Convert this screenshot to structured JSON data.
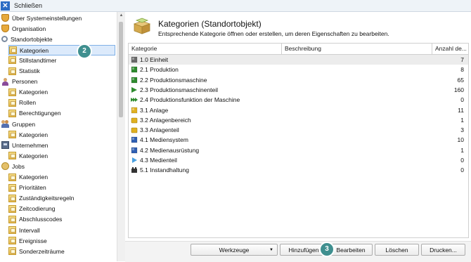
{
  "window": {
    "title": "Schließen"
  },
  "sidebar": {
    "items": [
      {
        "label": "Über Systemeinstellungen",
        "icon": "shield-icon",
        "level": 0
      },
      {
        "label": "Organisation",
        "icon": "shield-icon",
        "level": 0
      },
      {
        "label": "Standortobjekte",
        "icon": "search-icon",
        "level": 0
      },
      {
        "label": "Kategorien",
        "icon": "folder-icon",
        "level": 1,
        "selected": true
      },
      {
        "label": "Stillstandtimer",
        "icon": "folder-icon",
        "level": 1
      },
      {
        "label": "Statistik",
        "icon": "folder-icon",
        "level": 1
      },
      {
        "label": "Personen",
        "icon": "person-icon",
        "level": 0
      },
      {
        "label": "Kategorien",
        "icon": "folder-icon",
        "level": 1
      },
      {
        "label": "Rollen",
        "icon": "folder-icon",
        "level": 1
      },
      {
        "label": "Berechtigungen",
        "icon": "folder-icon",
        "level": 1
      },
      {
        "label": "Gruppen",
        "icon": "group-icon",
        "level": 0
      },
      {
        "label": "Kategorien",
        "icon": "folder-icon",
        "level": 1
      },
      {
        "label": "Unternehmen",
        "icon": "company-icon",
        "level": 0
      },
      {
        "label": "Kategorien",
        "icon": "folder-icon",
        "level": 1
      },
      {
        "label": "Jobs",
        "icon": "jobs-icon",
        "level": 0
      },
      {
        "label": "Kategorien",
        "icon": "folder-icon",
        "level": 1
      },
      {
        "label": "Prioritäten",
        "icon": "folder-icon",
        "level": 1
      },
      {
        "label": "Zuständigkeitsregeln",
        "icon": "folder-icon",
        "level": 1
      },
      {
        "label": "Zeitcodierung",
        "icon": "folder-icon",
        "level": 1
      },
      {
        "label": "Abschlusscodes",
        "icon": "folder-icon",
        "level": 1
      },
      {
        "label": "Intervall",
        "icon": "folder-icon",
        "level": 1
      },
      {
        "label": "Ereignisse",
        "icon": "folder-icon",
        "level": 1
      },
      {
        "label": "Sonderzeiträume",
        "icon": "folder-icon",
        "level": 1
      }
    ]
  },
  "badges": {
    "b2": "2",
    "b3": "3"
  },
  "main": {
    "title": "Kategorien (Standortobjekt)",
    "subtitle": "Entsprechende Kategorie öffnen oder erstellen, um deren Eigenschaften zu bearbeiten.",
    "columns": [
      "Kategorie",
      "Beschreibung",
      "Anzahl de..."
    ],
    "rows": [
      {
        "name": "1.0 Einheit",
        "count": "7",
        "icon": "unit-icon",
        "color": "#6b6b6b"
      },
      {
        "name": "2.1 Produktion",
        "count": "8",
        "icon": "production-icon",
        "color": "#2e8b2e"
      },
      {
        "name": "2.2 Produktionsmaschine",
        "count": "65",
        "icon": "machine-icon",
        "color": "#2e8b2e"
      },
      {
        "name": "2.3 Produktionsmaschinenteil",
        "count": "160",
        "icon": "machine-part-icon",
        "color": "#2e8b2e"
      },
      {
        "name": "2.4 Produktionsfunktion der Maschine",
        "count": "0",
        "icon": "machine-function-icon",
        "color": "#2e8b2e"
      },
      {
        "name": "3.1 Anlage",
        "count": "11",
        "icon": "plant-icon",
        "color": "#e0b020"
      },
      {
        "name": "3.2 Anlagenbereich",
        "count": "1",
        "icon": "plant-area-icon",
        "color": "#e0b020"
      },
      {
        "name": "3.3 Anlagenteil",
        "count": "3",
        "icon": "plant-part-icon",
        "color": "#e0b020"
      },
      {
        "name": "4.1 Mediensystem",
        "count": "10",
        "icon": "media-system-icon",
        "color": "#2f5fb3"
      },
      {
        "name": "4.2 Medienausrüstung",
        "count": "1",
        "icon": "media-equipment-icon",
        "color": "#2f5fb3"
      },
      {
        "name": "4.3 Medienteil",
        "count": "0",
        "icon": "media-part-icon",
        "color": "#2f5fb3"
      },
      {
        "name": "5.1 Instandhaltung",
        "count": "0",
        "icon": "maintenance-icon",
        "color": "#333333"
      }
    ]
  },
  "footer": {
    "tools_label": "Werkzeuge",
    "add_label": "Hinzufügen",
    "edit_label": "Bearbeiten",
    "delete_label": "Löschen",
    "print_label": "Drucken..."
  }
}
